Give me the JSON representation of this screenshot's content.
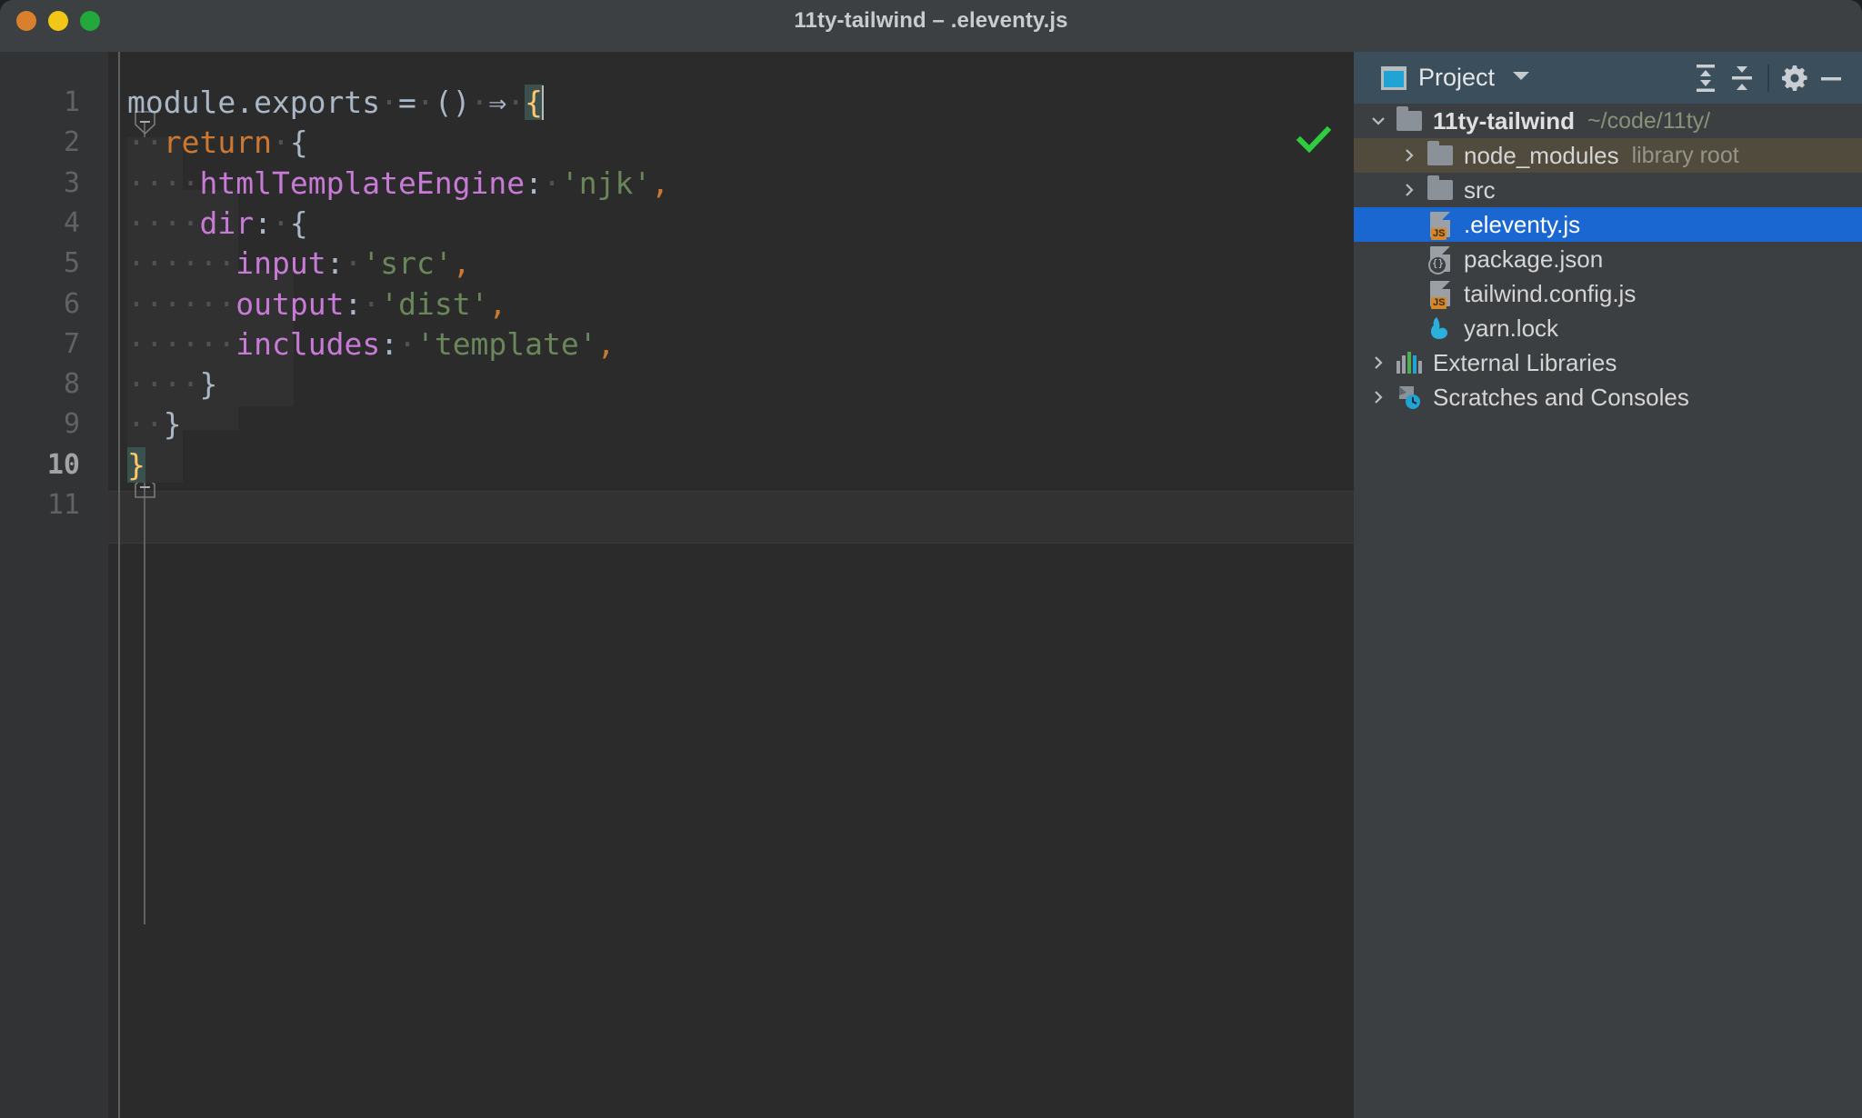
{
  "window": {
    "title": "11ty-tailwind – .eleventy.js",
    "traffic_lights": [
      "close-red",
      "minimize-yellow",
      "zoom-green"
    ],
    "colors": {
      "titlebar_bg": "#3c4043",
      "editor_bg": "#2b2b2b",
      "gutter_bg": "#313335",
      "panel_bg": "#3c3f41",
      "panel_header_bg": "#3b4e5c",
      "selection_blue": "#1a67d2",
      "library_root_bg": "#514b3d",
      "accent_string": "#6a8759",
      "accent_keyword": "#cc7832",
      "accent_property": "#c77ad6",
      "accent_brace_match": "#ffc66d",
      "inspection_ok": "#2ecc40"
    }
  },
  "editor": {
    "status_icon": "inspection-ok-check",
    "current_line": 10,
    "caret": {
      "line": 1,
      "column": 23
    },
    "line_numbers": [
      "1",
      "2",
      "3",
      "4",
      "5",
      "6",
      "7",
      "8",
      "9",
      "10",
      "11"
    ],
    "lines": [
      {
        "n": 1,
        "indent": 0,
        "fold": "expanded",
        "tokens": [
          {
            "t": "module.exports",
            "c": "default"
          },
          {
            "t": " ",
            "c": "ws"
          },
          {
            "t": "=",
            "c": "punct"
          },
          {
            "t": " ",
            "c": "ws"
          },
          {
            "t": "()",
            "c": "punct"
          },
          {
            "t": " ",
            "c": "ws"
          },
          {
            "t": "⇒",
            "c": "punct"
          },
          {
            "t": " ",
            "c": "ws"
          },
          {
            "t": "{",
            "c": "brace-hl"
          }
        ]
      },
      {
        "n": 2,
        "indent": 1,
        "fold": "expanded",
        "tokens": [
          {
            "t": "return",
            "c": "key"
          },
          {
            "t": " ",
            "c": "ws"
          },
          {
            "t": "{",
            "c": "punct"
          }
        ]
      },
      {
        "n": 3,
        "indent": 2,
        "fold": "none",
        "tokens": [
          {
            "t": "htmlTemplateEngine",
            "c": "prop"
          },
          {
            "t": ":",
            "c": "punct"
          },
          {
            "t": " ",
            "c": "ws"
          },
          {
            "t": "'njk'",
            "c": "str"
          },
          {
            "t": ",",
            "c": "comma"
          }
        ]
      },
      {
        "n": 4,
        "indent": 2,
        "fold": "expanded",
        "tokens": [
          {
            "t": "dir",
            "c": "prop"
          },
          {
            "t": ":",
            "c": "punct"
          },
          {
            "t": " ",
            "c": "ws"
          },
          {
            "t": "{",
            "c": "punct"
          }
        ]
      },
      {
        "n": 5,
        "indent": 3,
        "fold": "none",
        "tokens": [
          {
            "t": "input",
            "c": "prop"
          },
          {
            "t": ":",
            "c": "punct"
          },
          {
            "t": " ",
            "c": "ws"
          },
          {
            "t": "'src'",
            "c": "str"
          },
          {
            "t": ",",
            "c": "comma"
          }
        ]
      },
      {
        "n": 6,
        "indent": 3,
        "fold": "none",
        "tokens": [
          {
            "t": "output",
            "c": "prop"
          },
          {
            "t": ":",
            "c": "punct"
          },
          {
            "t": " ",
            "c": "ws"
          },
          {
            "t": "'dist'",
            "c": "str"
          },
          {
            "t": ",",
            "c": "comma"
          }
        ]
      },
      {
        "n": 7,
        "indent": 3,
        "fold": "none",
        "tokens": [
          {
            "t": "includes",
            "c": "prop"
          },
          {
            "t": ":",
            "c": "punct"
          },
          {
            "t": " ",
            "c": "ws"
          },
          {
            "t": "'template'",
            "c": "str"
          },
          {
            "t": ",",
            "c": "comma"
          }
        ]
      },
      {
        "n": 8,
        "indent": 2,
        "fold": "collapse-end",
        "tokens": [
          {
            "t": "}",
            "c": "punct"
          }
        ]
      },
      {
        "n": 9,
        "indent": 1,
        "fold": "collapse-end",
        "tokens": [
          {
            "t": "}",
            "c": "punct"
          }
        ]
      },
      {
        "n": 10,
        "indent": 0,
        "fold": "collapse-end",
        "tokens": [
          {
            "t": "}",
            "c": "brace-hl"
          }
        ]
      },
      {
        "n": 11,
        "indent": 0,
        "fold": "none",
        "tokens": []
      }
    ],
    "plain_text": "module.exports = () => {\n  return {\n    htmlTemplateEngine: 'njk',\n    dir: {\n      input: 'src',\n      output: 'dist',\n      includes: 'template',\n    }\n  }\n}\n"
  },
  "project_panel": {
    "header": {
      "icon": "project-window-icon",
      "title": "Project",
      "dropdown_icon": "chevron-down-icon",
      "buttons": [
        {
          "name": "expand-all-icon",
          "label": "Expand All"
        },
        {
          "name": "collapse-all-icon",
          "label": "Collapse All"
        },
        {
          "name": "settings-gear-icon",
          "label": "Options"
        },
        {
          "name": "hide-panel-icon",
          "label": "Hide"
        }
      ]
    },
    "tree": [
      {
        "label": "11ty-tailwind",
        "hint": "~/code/11ty/",
        "icon": "folder-icon",
        "depth": 0,
        "arrow": "expanded",
        "state": "normal",
        "bold": true
      },
      {
        "label": "node_modules",
        "hint": "library root",
        "icon": "folder-icon",
        "depth": 1,
        "arrow": "collapsed",
        "state": "library-root",
        "bold": false
      },
      {
        "label": "src",
        "hint": "",
        "icon": "folder-icon",
        "depth": 1,
        "arrow": "collapsed",
        "state": "normal",
        "bold": false
      },
      {
        "label": ".eleventy.js",
        "hint": "",
        "icon": "js-file-icon",
        "depth": 1,
        "arrow": "none",
        "state": "selected",
        "bold": false
      },
      {
        "label": "package.json",
        "hint": "",
        "icon": "json-file-icon",
        "depth": 1,
        "arrow": "none",
        "state": "normal",
        "bold": false
      },
      {
        "label": "tailwind.config.js",
        "hint": "",
        "icon": "js-file-icon",
        "depth": 1,
        "arrow": "none",
        "state": "normal",
        "bold": false
      },
      {
        "label": "yarn.lock",
        "hint": "",
        "icon": "yarn-file-icon",
        "depth": 1,
        "arrow": "none",
        "state": "normal",
        "bold": false
      },
      {
        "label": "External Libraries",
        "hint": "",
        "icon": "external-libraries-icon",
        "depth": 0,
        "arrow": "collapsed",
        "state": "normal",
        "bold": false
      },
      {
        "label": "Scratches and Consoles",
        "hint": "",
        "icon": "scratches-icon",
        "depth": 0,
        "arrow": "collapsed",
        "state": "normal",
        "bold": false
      }
    ]
  }
}
